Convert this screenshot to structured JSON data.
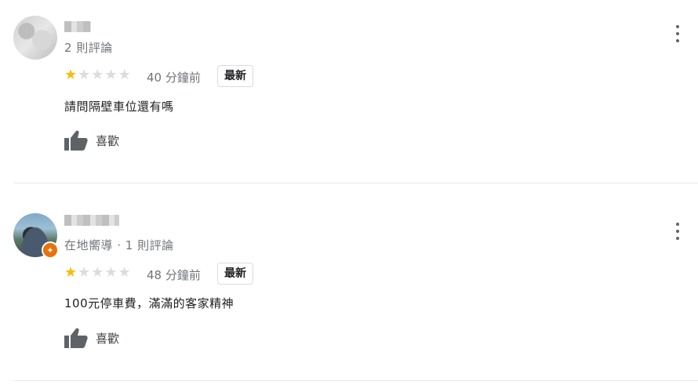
{
  "reviews": [
    {
      "reviewer_meta": "2 則評論",
      "rating": 1,
      "rating_max": 5,
      "time": "40 分鐘前",
      "tag": "最新",
      "text": "請問隔壁車位還有嗎",
      "like_label": "喜歡",
      "avatar_icon": "blurred-avatar",
      "more_icon": "more-vert-icon"
    },
    {
      "reviewer_meta": "在地嚮導 · 1 則評論",
      "rating": 1,
      "rating_max": 5,
      "time": "48 分鐘前",
      "tag": "最新",
      "text": "100元停車費，滿滿的客家精神",
      "like_label": "喜歡",
      "avatar_icon": "motorcycle-photo-avatar",
      "badge_icon": "local-guide-badge-icon",
      "more_icon": "more-vert-icon"
    }
  ],
  "colors": {
    "star_on": "#fbbc04",
    "star_off": "#dadce0",
    "badge": "#e8710a",
    "divider": "#e8eaed"
  }
}
